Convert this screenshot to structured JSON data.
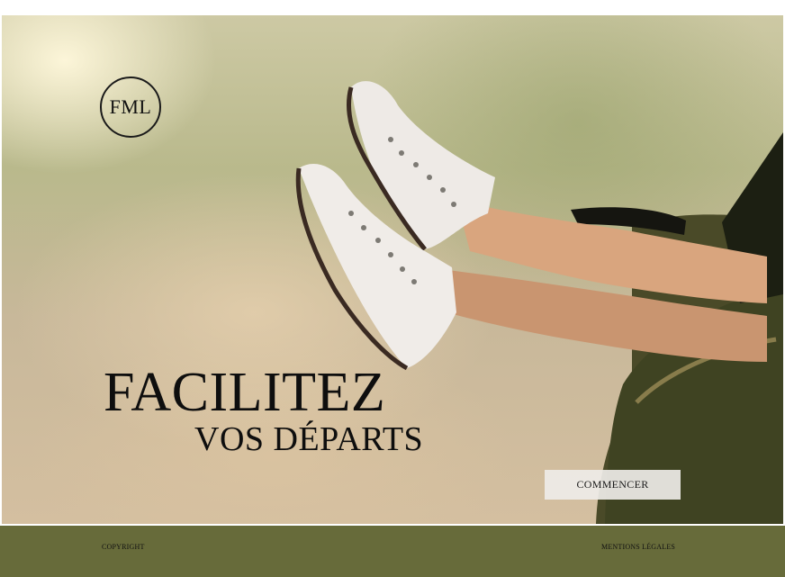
{
  "hero": {
    "image": "Photo: legs in white sneakers stretched out of a car window",
    "logo_text": "FML",
    "headline": "FACILITEZ",
    "subheadline": "VOS DÉPARTS",
    "cta_label": "COMMENCER"
  },
  "footer": {
    "left_link": "COPYRIGHT",
    "right_link": "MENTIONS LÉGALES",
    "background_color": "#676b3a"
  }
}
